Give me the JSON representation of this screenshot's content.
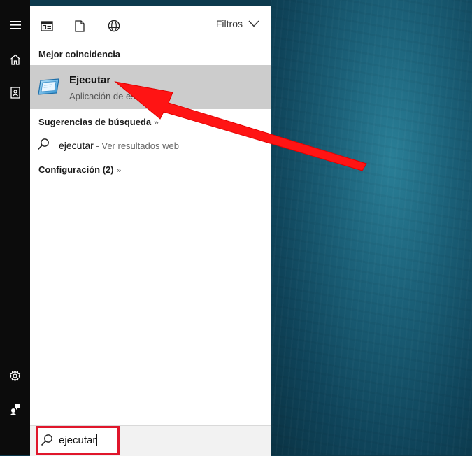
{
  "rail": {
    "items": [
      {
        "name": "hamburger-menu-icon"
      },
      {
        "name": "home-icon"
      },
      {
        "name": "notebook-icon"
      },
      {
        "name": "gear-icon"
      },
      {
        "name": "feedback-icon"
      }
    ]
  },
  "topbar": {
    "icons": [
      "apps-icon",
      "documents-icon",
      "web-icon"
    ],
    "filters_label": "Filtros"
  },
  "best_match": {
    "heading": "Mejor coincidencia",
    "title": "Ejecutar",
    "subtitle": "Aplicación de es"
  },
  "suggestions": {
    "heading": "Sugerencias de búsqueda",
    "chevron": "»",
    "query": "ejecutar",
    "suffix": " - Ver resultados web"
  },
  "settings": {
    "heading": "Configuración (2)",
    "chevron": "»"
  },
  "search": {
    "value": "ejecutar"
  },
  "colors": {
    "highlight": "#cccccc",
    "annotation_red": "#e0162b",
    "rail": "#0c0c0c"
  }
}
